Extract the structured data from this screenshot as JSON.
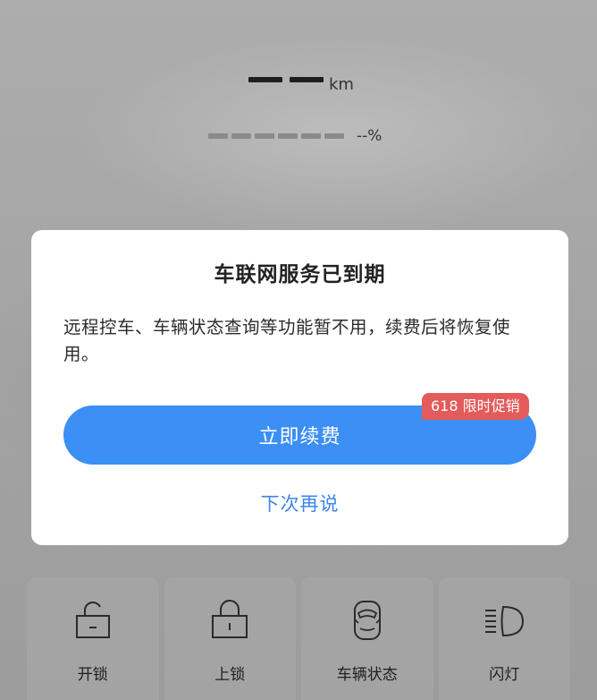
{
  "dashboard": {
    "mileage_unit": "km",
    "battery_percent": "--%"
  },
  "modal": {
    "title": "车联网服务已到期",
    "message": "远程控车、车辆状态查询等功能暂不用，续费后将恢复使用。",
    "renew_label": "立即续费",
    "promo_badge": "618 限时促销",
    "later_label": "下次再说",
    "colors": {
      "primary": "#3b8ff5",
      "badge": "#e45b5b",
      "link": "#3a86e8"
    }
  },
  "controls": [
    {
      "label": "开锁",
      "icon": "unlock-icon"
    },
    {
      "label": "上锁",
      "icon": "lock-icon"
    },
    {
      "label": "车辆状态",
      "icon": "car-status-icon"
    },
    {
      "label": "闪灯",
      "icon": "headlight-flash-icon"
    }
  ]
}
